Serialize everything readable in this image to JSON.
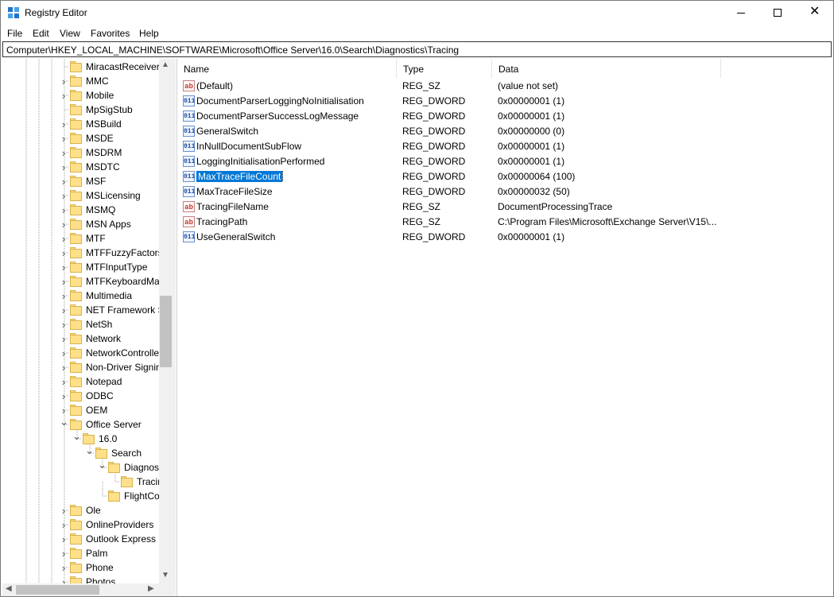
{
  "window": {
    "title": "Registry Editor"
  },
  "menu": [
    "File",
    "Edit",
    "View",
    "Favorites",
    "Help"
  ],
  "address": "Computer\\HKEY_LOCAL_MACHINE\\SOFTWARE\\Microsoft\\Office Server\\16.0\\Search\\Diagnostics\\Tracing",
  "tree": [
    {
      "label": "MiracastReceiver",
      "level": 0,
      "expander": "none"
    },
    {
      "label": "MMC",
      "level": 0,
      "expander": "collapsed"
    },
    {
      "label": "Mobile",
      "level": 0,
      "expander": "collapsed"
    },
    {
      "label": "MpSigStub",
      "level": 0,
      "expander": "none"
    },
    {
      "label": "MSBuild",
      "level": 0,
      "expander": "collapsed"
    },
    {
      "label": "MSDE",
      "level": 0,
      "expander": "collapsed"
    },
    {
      "label": "MSDRM",
      "level": 0,
      "expander": "collapsed"
    },
    {
      "label": "MSDTC",
      "level": 0,
      "expander": "collapsed"
    },
    {
      "label": "MSF",
      "level": 0,
      "expander": "collapsed"
    },
    {
      "label": "MSLicensing",
      "level": 0,
      "expander": "collapsed"
    },
    {
      "label": "MSMQ",
      "level": 0,
      "expander": "collapsed"
    },
    {
      "label": "MSN Apps",
      "level": 0,
      "expander": "collapsed"
    },
    {
      "label": "MTF",
      "level": 0,
      "expander": "collapsed"
    },
    {
      "label": "MTFFuzzyFactors",
      "level": 0,
      "expander": "collapsed"
    },
    {
      "label": "MTFInputType",
      "level": 0,
      "expander": "collapsed"
    },
    {
      "label": "MTFKeyboardMa",
      "level": 0,
      "expander": "collapsed"
    },
    {
      "label": "Multimedia",
      "level": 0,
      "expander": "collapsed"
    },
    {
      "label": "NET Framework S",
      "level": 0,
      "expander": "collapsed"
    },
    {
      "label": "NetSh",
      "level": 0,
      "expander": "collapsed"
    },
    {
      "label": "Network",
      "level": 0,
      "expander": "collapsed"
    },
    {
      "label": "NetworkControlle",
      "level": 0,
      "expander": "collapsed"
    },
    {
      "label": "Non-Driver Signin",
      "level": 0,
      "expander": "collapsed"
    },
    {
      "label": "Notepad",
      "level": 0,
      "expander": "collapsed"
    },
    {
      "label": "ODBC",
      "level": 0,
      "expander": "collapsed"
    },
    {
      "label": "OEM",
      "level": 0,
      "expander": "collapsed"
    },
    {
      "label": "Office Server",
      "level": 0,
      "expander": "expanded"
    },
    {
      "label": "16.0",
      "level": 1,
      "expander": "expanded"
    },
    {
      "label": "Search",
      "level": 2,
      "expander": "expanded"
    },
    {
      "label": "Diagnos",
      "level": 3,
      "expander": "expanded"
    },
    {
      "label": "Tracin",
      "level": 4,
      "expander": "none"
    },
    {
      "label": "FlightCo",
      "level": 3,
      "expander": "none"
    },
    {
      "label": "Ole",
      "level": 0,
      "expander": "collapsed"
    },
    {
      "label": "OnlineProviders",
      "level": 0,
      "expander": "collapsed"
    },
    {
      "label": "Outlook Express",
      "level": 0,
      "expander": "collapsed"
    },
    {
      "label": "Palm",
      "level": 0,
      "expander": "collapsed"
    },
    {
      "label": "Phone",
      "level": 0,
      "expander": "collapsed"
    },
    {
      "label": "Photos",
      "level": 0,
      "expander": "collapsed"
    }
  ],
  "list": {
    "columns": [
      "Name",
      "Type",
      "Data"
    ],
    "rows": [
      {
        "name": "(Default)",
        "type": "REG_SZ",
        "data": "(value not set)",
        "icon": "string"
      },
      {
        "name": "DocumentParserLoggingNoInitialisation",
        "type": "REG_DWORD",
        "data": "0x00000001 (1)",
        "icon": "binary"
      },
      {
        "name": "DocumentParserSuccessLogMessage",
        "type": "REG_DWORD",
        "data": "0x00000001 (1)",
        "icon": "binary"
      },
      {
        "name": "GeneralSwitch",
        "type": "REG_DWORD",
        "data": "0x00000000 (0)",
        "icon": "binary"
      },
      {
        "name": "InNullDocumentSubFlow",
        "type": "REG_DWORD",
        "data": "0x00000001 (1)",
        "icon": "binary"
      },
      {
        "name": "LoggingInitialisationPerformed",
        "type": "REG_DWORD",
        "data": "0x00000001 (1)",
        "icon": "binary"
      },
      {
        "name": "MaxTraceFileCount",
        "type": "REG_DWORD",
        "data": "0x00000064 (100)",
        "icon": "binary",
        "selected": true
      },
      {
        "name": "MaxTraceFileSize",
        "type": "REG_DWORD",
        "data": "0x00000032 (50)",
        "icon": "binary"
      },
      {
        "name": "TracingFileName",
        "type": "REG_SZ",
        "data": "DocumentProcessingTrace",
        "icon": "string"
      },
      {
        "name": "TracingPath",
        "type": "REG_SZ",
        "data": "C:\\Program Files\\Microsoft\\Exchange Server\\V15\\...",
        "icon": "string"
      },
      {
        "name": "UseGeneralSwitch",
        "type": "REG_DWORD",
        "data": "0x00000001 (1)",
        "icon": "binary"
      }
    ]
  },
  "colors": {
    "selection": "#0078d7",
    "folder": "#ffe08a"
  }
}
